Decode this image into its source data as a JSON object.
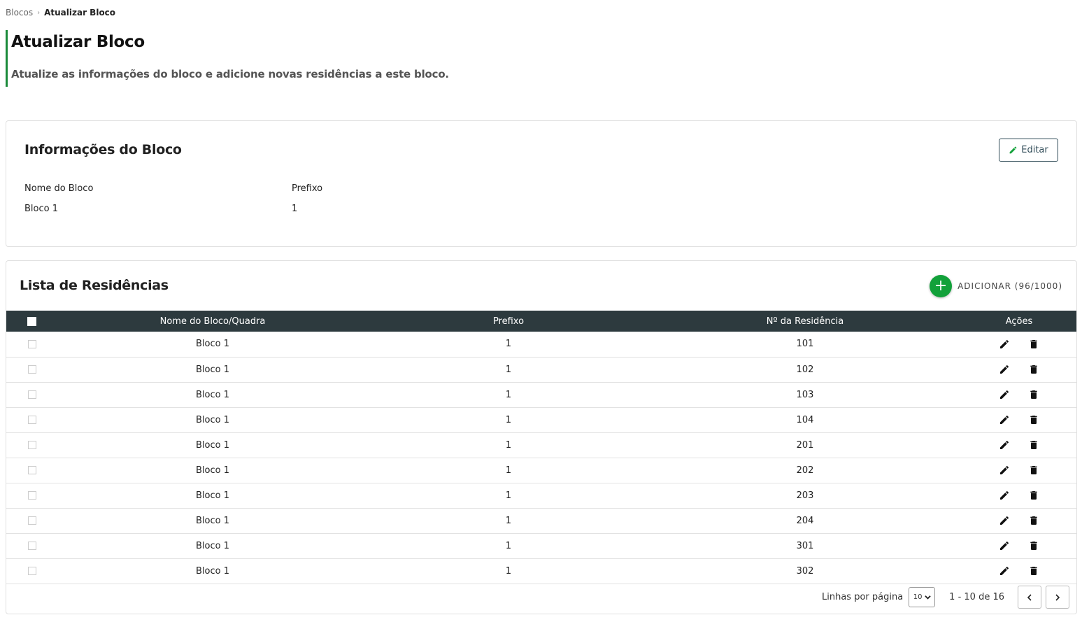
{
  "breadcrumb": {
    "parent": "Blocos",
    "separator": "›",
    "current": "Atualizar Bloco"
  },
  "header": {
    "title": "Atualizar Bloco",
    "subtitle": "Atualize as informações do bloco e adicione novas residências a este bloco."
  },
  "info_card": {
    "title": "Informações do Bloco",
    "edit_label": "Editar",
    "fields": [
      {
        "label": "Nome do Bloco",
        "value": "Bloco 1"
      },
      {
        "label": "Prefixo",
        "value": "1"
      }
    ]
  },
  "list_card": {
    "title": "Lista de Residências",
    "add_label": "ADICIONAR (96/1000)",
    "add_icon": "+",
    "columns": [
      "Nome do Bloco/Quadra",
      "Prefixo",
      "Nº da Residência",
      "Ações"
    ],
    "rows": [
      {
        "name": "Bloco 1",
        "prefix": "1",
        "number": "101"
      },
      {
        "name": "Bloco 1",
        "prefix": "1",
        "number": "102"
      },
      {
        "name": "Bloco 1",
        "prefix": "1",
        "number": "103"
      },
      {
        "name": "Bloco 1",
        "prefix": "1",
        "number": "104"
      },
      {
        "name": "Bloco 1",
        "prefix": "1",
        "number": "201"
      },
      {
        "name": "Bloco 1",
        "prefix": "1",
        "number": "202"
      },
      {
        "name": "Bloco 1",
        "prefix": "1",
        "number": "203"
      },
      {
        "name": "Bloco 1",
        "prefix": "1",
        "number": "204"
      },
      {
        "name": "Bloco 1",
        "prefix": "1",
        "number": "301"
      },
      {
        "name": "Bloco 1",
        "prefix": "1",
        "number": "302"
      }
    ]
  },
  "pagination": {
    "rows_label": "Linhas por página",
    "rows_value": "10",
    "range": "1 - 10 de 16"
  },
  "icons": {
    "edit": "pencil-icon",
    "delete": "trash-icon",
    "add": "plus-icon",
    "prev": "chevron-left-icon",
    "next": "chevron-right-icon"
  },
  "colors": {
    "accent": "#1b8a3a",
    "add_button": "#12a13a",
    "table_header": "#2d3a3e",
    "edit_button": "#2e4a56"
  }
}
